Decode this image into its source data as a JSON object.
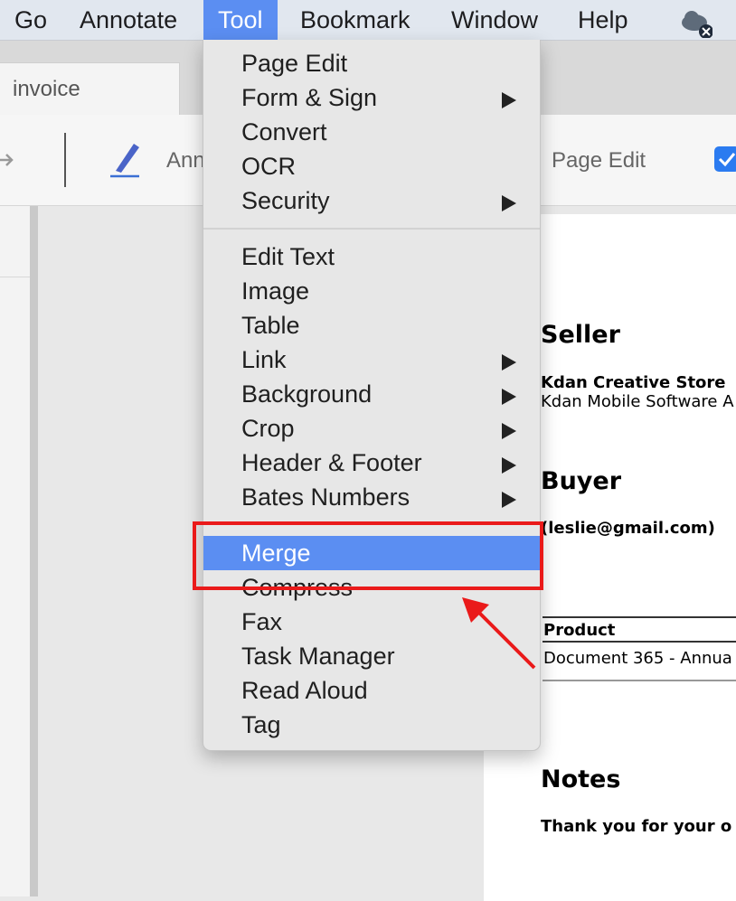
{
  "menubar": {
    "items": [
      "Go",
      "Annotate",
      "Tool",
      "Bookmark",
      "Window",
      "Help"
    ],
    "active": "Tool"
  },
  "tab": {
    "label": "invoice"
  },
  "toolbar": {
    "annotate_partial": "Ann",
    "page_edit": "Page Edit"
  },
  "tool_menu": {
    "group1": [
      {
        "label": "Page Edit",
        "submenu": false
      },
      {
        "label": "Form & Sign",
        "submenu": true
      },
      {
        "label": "Convert",
        "submenu": false
      },
      {
        "label": "OCR",
        "submenu": false
      },
      {
        "label": "Security",
        "submenu": true
      }
    ],
    "group2": [
      {
        "label": "Edit Text",
        "submenu": false
      },
      {
        "label": "Image",
        "submenu": false
      },
      {
        "label": "Table",
        "submenu": false
      },
      {
        "label": "Link",
        "submenu": true
      },
      {
        "label": "Background",
        "submenu": true
      },
      {
        "label": "Crop",
        "submenu": true
      },
      {
        "label": "Header & Footer",
        "submenu": true
      },
      {
        "label": "Bates Numbers",
        "submenu": true
      },
      {
        "label": "Merge",
        "submenu": false,
        "highlighted": true
      },
      {
        "label": "Compress",
        "submenu": false
      },
      {
        "label": "Fax",
        "submenu": false
      },
      {
        "label": "Task Manager",
        "submenu": false
      },
      {
        "label": "Read Aloud",
        "submenu": false
      },
      {
        "label": "Tag",
        "submenu": false
      }
    ]
  },
  "document": {
    "seller_heading": "Seller",
    "seller_name": "Kdan Creative Store",
    "seller_company": "Kdan Mobile Software A",
    "buyer_heading": "Buyer",
    "buyer_email": "(leslie@gmail.com)",
    "product_header": "Product",
    "product_row": "Document 365 - Annua",
    "notes_heading": "Notes",
    "notes_text": "Thank you for your o"
  },
  "colors": {
    "highlight": "#5b8ef2",
    "annotation_red": "#ea1a1a"
  }
}
